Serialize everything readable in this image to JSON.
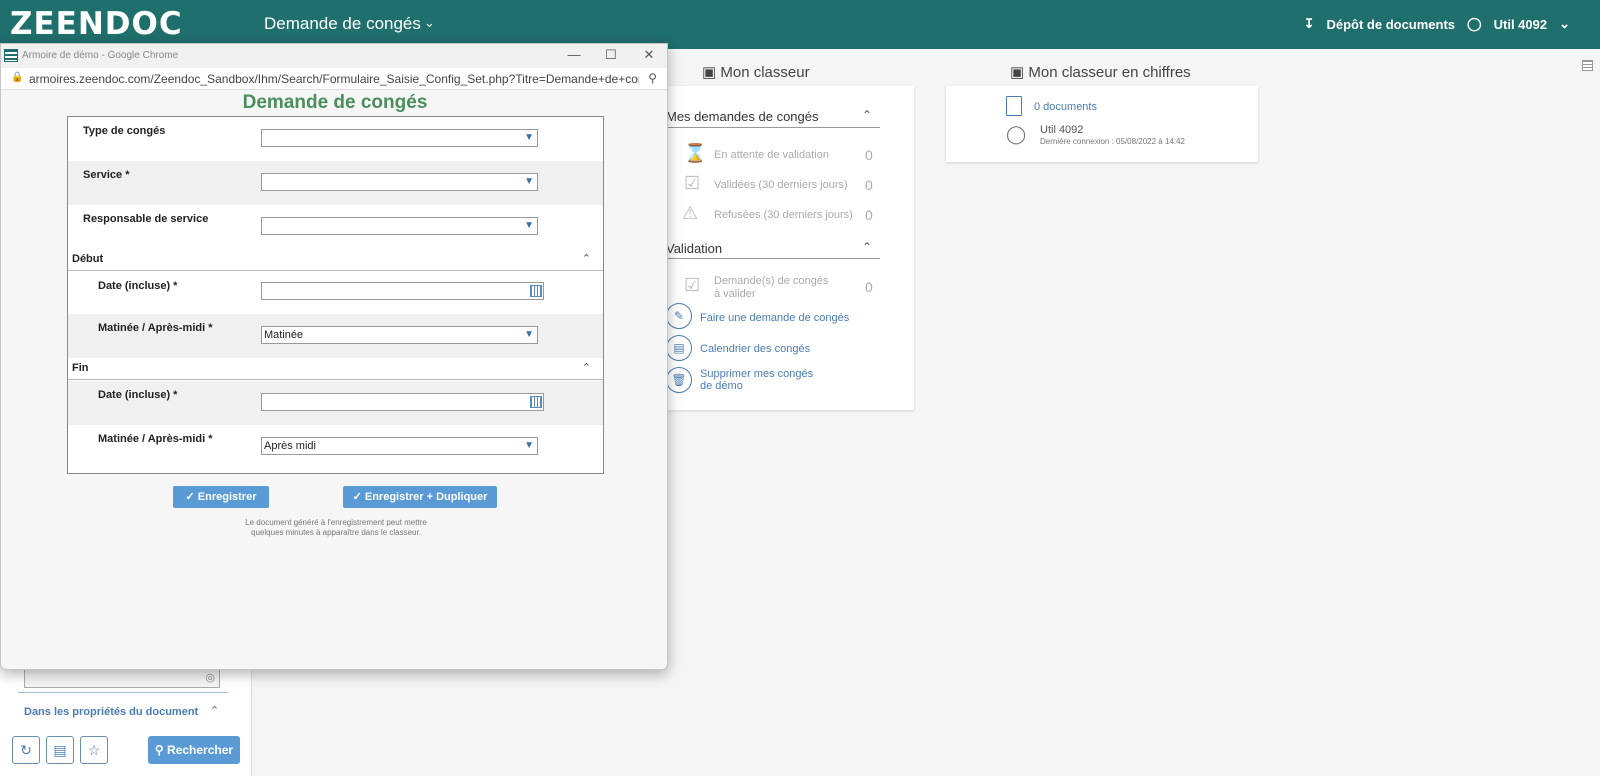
{
  "topbar": {
    "logo": "ZEENDOC",
    "app_title": "Demande de congés",
    "chevron": "chevron-down-icon",
    "upload_label": "Dépôt de documents",
    "user_label": "Util 4092"
  },
  "left_panel": {
    "section_label": "Dans les propriétés du document",
    "search_label": "Rechercher"
  },
  "dashboard": {
    "classeur_title": "Mon classeur",
    "chiffres_title": "Mon classeur en chiffres",
    "demandes_group": "Mes demandes de congés",
    "stats": [
      {
        "label": "En attente de validation",
        "value": "0"
      },
      {
        "label": "Validées (30 derniers jours)",
        "value": "0"
      },
      {
        "label": "Refusées (30 derniers jours)",
        "value": "0"
      }
    ],
    "validation_group": "Validation",
    "validation_stat": {
      "label": "Demande(s) de congés à valider",
      "value": "0"
    },
    "actions": [
      {
        "label": "Faire une demande de congés"
      },
      {
        "label": "Calendrier des congés"
      },
      {
        "label": "Supprimer mes congés de démo"
      }
    ],
    "chiffres": {
      "documents": "0 documents",
      "user": "Util 4092",
      "last_login": "Dernière connexion : 05/08/2022 à 14:42"
    }
  },
  "popup": {
    "window_title": "Armoire de démo - Google Chrome",
    "url": "armoires.zeendoc.com/Zeendoc_Sandbox/Ihm/Search/Formulaire_Saisie_Config_Set.php?Titre=Demande+de+cong...",
    "form_title": "Demande de congés",
    "fields": {
      "type_conges": {
        "label": "Type de congés",
        "value": ""
      },
      "service": {
        "label": "Service *",
        "value": ""
      },
      "responsable": {
        "label": "Responsable de service",
        "value": ""
      },
      "debut_section": "Début",
      "debut_date": {
        "label": "Date (incluse) *",
        "value": ""
      },
      "debut_periode": {
        "label": "Matinée / Après-midi *",
        "value": "Matinée"
      },
      "fin_section": "Fin",
      "fin_date": {
        "label": "Date (incluse) *",
        "value": ""
      },
      "fin_periode": {
        "label": "Matinée / Après-midi *",
        "value": "Après midi"
      }
    },
    "buttons": {
      "save": "Enregistrer",
      "save_dup": "Enregistrer + Dupliquer"
    },
    "note_line1": "Le document généré à l'enregistrement peut mettre",
    "note_line2": "quelques minutes à apparaître dans le classeur."
  },
  "colors": {
    "topbar": "#1f6f6c",
    "accent": "#5a9bd5",
    "form_title": "#4a8e5c",
    "link": "#4a7db5"
  }
}
